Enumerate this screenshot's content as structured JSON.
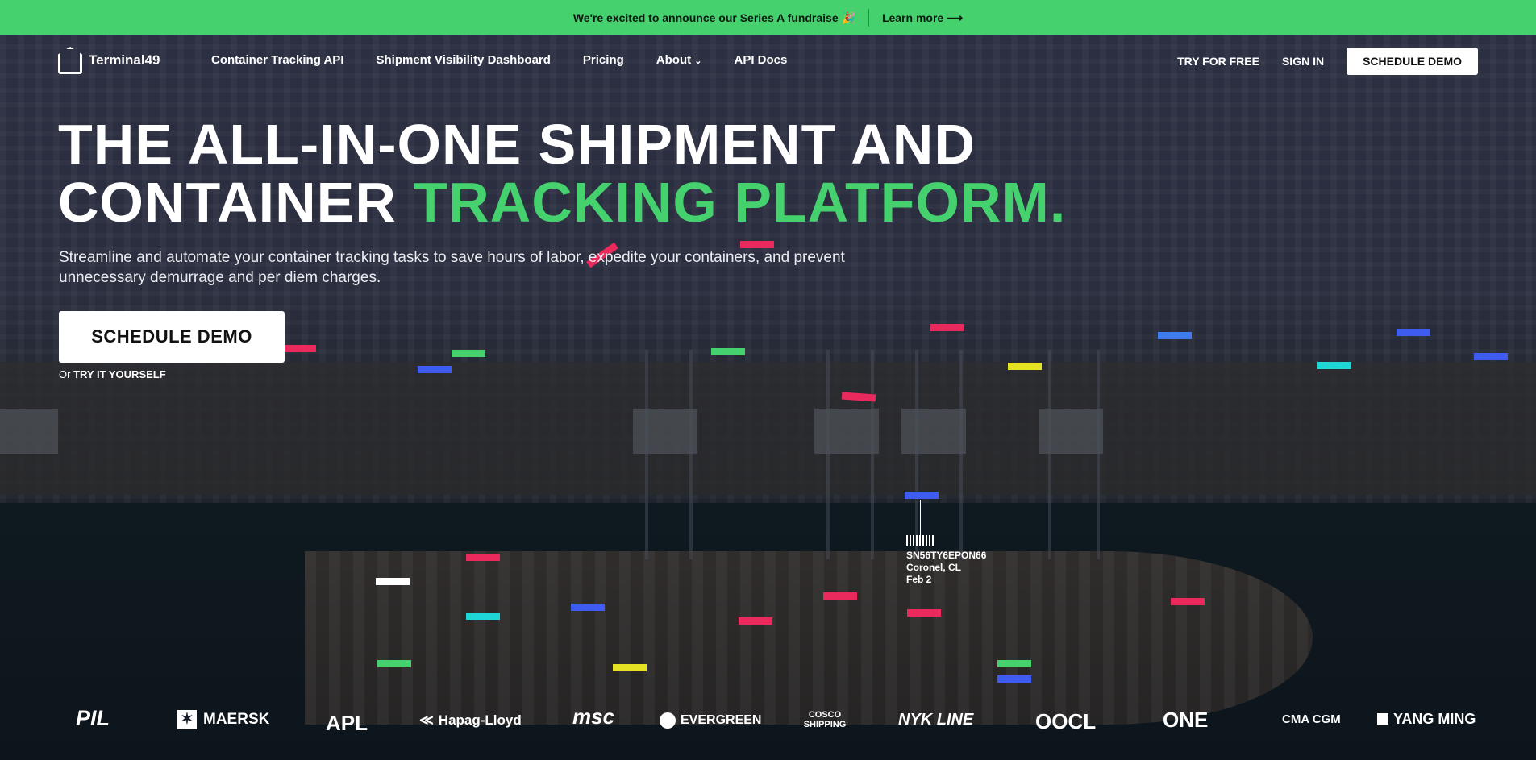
{
  "announcement": {
    "text": "We're excited to announce our Series A fundraise 🎉",
    "link": "Learn more ⟶"
  },
  "brand": {
    "name": "Terminal49"
  },
  "nav": {
    "links": [
      "Container Tracking API",
      "Shipment Visibility Dashboard",
      "Pricing",
      "About",
      "API Docs"
    ],
    "about_chevron": "chevron-down-icon",
    "try_free": "TRY FOR FREE",
    "sign_in": "SIGN IN",
    "schedule_demo": "SCHEDULE DEMO"
  },
  "hero": {
    "headline_line1": "THE ALL-IN-ONE SHIPMENT AND",
    "headline_line2_a": "CONTAINER ",
    "headline_line2_b": "TRACKING PLATFORM.",
    "subtitle": "Streamline and automate your container tracking tasks to save hours of labor, expedite your containers, and prevent unnecessary demurrage and per diem charges.",
    "cta": "SCHEDULE DEMO",
    "try_prefix": "Or ",
    "try_link": "TRY IT YOURSELF",
    "accent": "#45d26e"
  },
  "container_tag": {
    "id": "SN56TY6EPON66",
    "location": "Coronel, CL",
    "date": "Feb 2"
  },
  "carrier_logos": [
    "PIL",
    "MAERSK",
    "APL",
    "Hapag-Lloyd",
    "msc",
    "EVERGREEN",
    "COSCO SHIPPING",
    "NYK LINE",
    "OOCL",
    "ONE",
    "CMA CGM",
    "YANG MING"
  ]
}
